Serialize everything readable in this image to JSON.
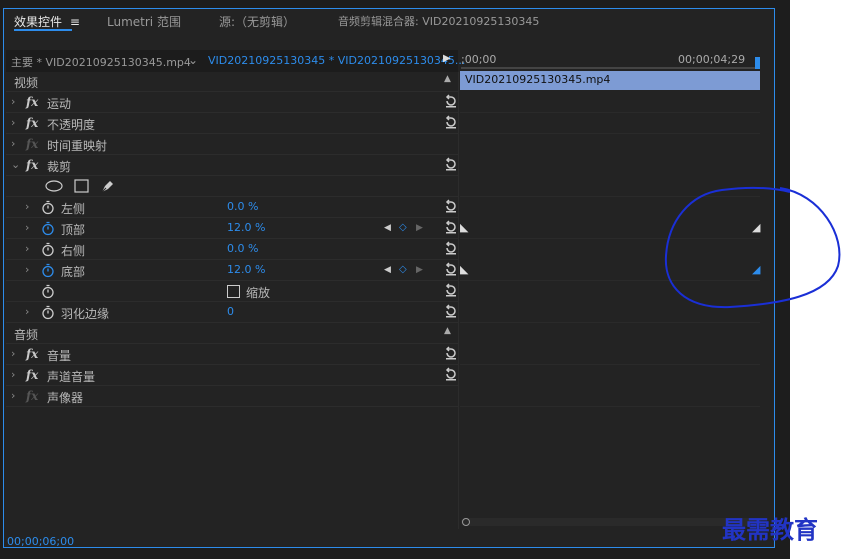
{
  "tabs": [
    {
      "label": "效果控件",
      "active": true
    },
    {
      "label": "Lumetri 范围"
    },
    {
      "label": "源:（无剪辑）"
    },
    {
      "label": "音频剪辑混合器: VID20210925130345"
    }
  ],
  "clip_selector": {
    "master": "主要 * VID20210925130345.mp4",
    "sequence": "VID20210925130345 * VID20210925130345..."
  },
  "timeline": {
    "start": ";00;00",
    "end": "00;00;04;29",
    "clip": "VID20210925130345.mp4"
  },
  "sections": {
    "video": "视频",
    "audio": "音频"
  },
  "video_effects": [
    "运动",
    "不透明度",
    "时间重映射",
    "裁剪"
  ],
  "crop_params": [
    {
      "label": "左侧",
      "value": "0.0 %"
    },
    {
      "label": "顶部",
      "value": "12.0 %"
    },
    {
      "label": "右侧",
      "value": "0.0 %"
    },
    {
      "label": "底部",
      "value": "12.0 %"
    },
    {
      "label": "缩放",
      "value": ""
    },
    {
      "label": "羽化边缘",
      "value": "0"
    }
  ],
  "audio_effects": [
    "音量",
    "声道音量",
    "声像器"
  ],
  "timecode": "00;00;06;00",
  "watermark": "最需教育",
  "colors": {
    "accent": "#2d8ceb",
    "annotation": "#1a2fd6"
  }
}
